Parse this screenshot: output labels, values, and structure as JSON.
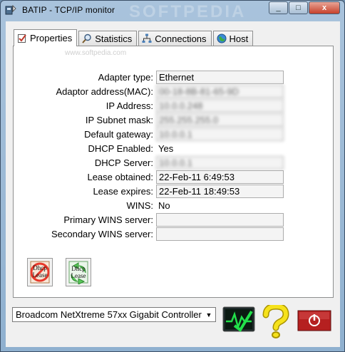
{
  "window": {
    "title": "BATIP - TCP/IP monitor",
    "watermark": "SOFTPEDIA",
    "close_label": "x",
    "min_label": "_",
    "max_label": "□"
  },
  "tabs": [
    {
      "label": "Properties",
      "icon": "properties-icon",
      "active": true
    },
    {
      "label": "Statistics",
      "icon": "search-icon",
      "active": false
    },
    {
      "label": "Connections",
      "icon": "network-icon",
      "active": false
    },
    {
      "label": "Host",
      "icon": "globe-icon",
      "active": false
    }
  ],
  "panel_watermark": "www.softpedia.com",
  "properties": [
    {
      "label": "Adapter type:",
      "value": "Ethernet",
      "boxed": true,
      "blurred": false
    },
    {
      "label": "Adaptor address(MAC):",
      "value": "00-18-8B-81-65-9D",
      "boxed": true,
      "blurred": true
    },
    {
      "label": "IP Address:",
      "value": "10.0.0.248",
      "boxed": true,
      "blurred": true
    },
    {
      "label": "IP Subnet mask:",
      "value": "255.255.255.0",
      "boxed": true,
      "blurred": true
    },
    {
      "label": "Default gateway:",
      "value": "10.0.0.1",
      "boxed": true,
      "blurred": true
    },
    {
      "label": "DHCP Enabled:",
      "value": "Yes",
      "boxed": false,
      "blurred": false
    },
    {
      "label": "DHCP Server:",
      "value": "10.0.0.1",
      "boxed": true,
      "blurred": true
    },
    {
      "label": "Lease obtained:",
      "value": "22-Feb-11 6:49:53",
      "boxed": true,
      "blurred": false
    },
    {
      "label": "Lease expires:",
      "value": "22-Feb-11 18:49:53",
      "boxed": true,
      "blurred": false
    },
    {
      "label": "WINS:",
      "value": "No",
      "boxed": false,
      "blurred": false
    },
    {
      "label": "Primary WINS server:",
      "value": "",
      "boxed": true,
      "blurred": false
    },
    {
      "label": "Secondary WINS server:",
      "value": "",
      "boxed": true,
      "blurred": false
    }
  ],
  "dhcp_buttons": {
    "release_text": "Dhcp Lease",
    "renew_text": "Dhcp Lease"
  },
  "adapter_select": {
    "value": "Broadcom NetXtreme 57xx Gigabit Controller"
  },
  "colors": {
    "accent": "#3a6ea5",
    "monitor_green": "#22e04a",
    "help_yellow": "#f6e21b",
    "power_red": "#b52020"
  }
}
